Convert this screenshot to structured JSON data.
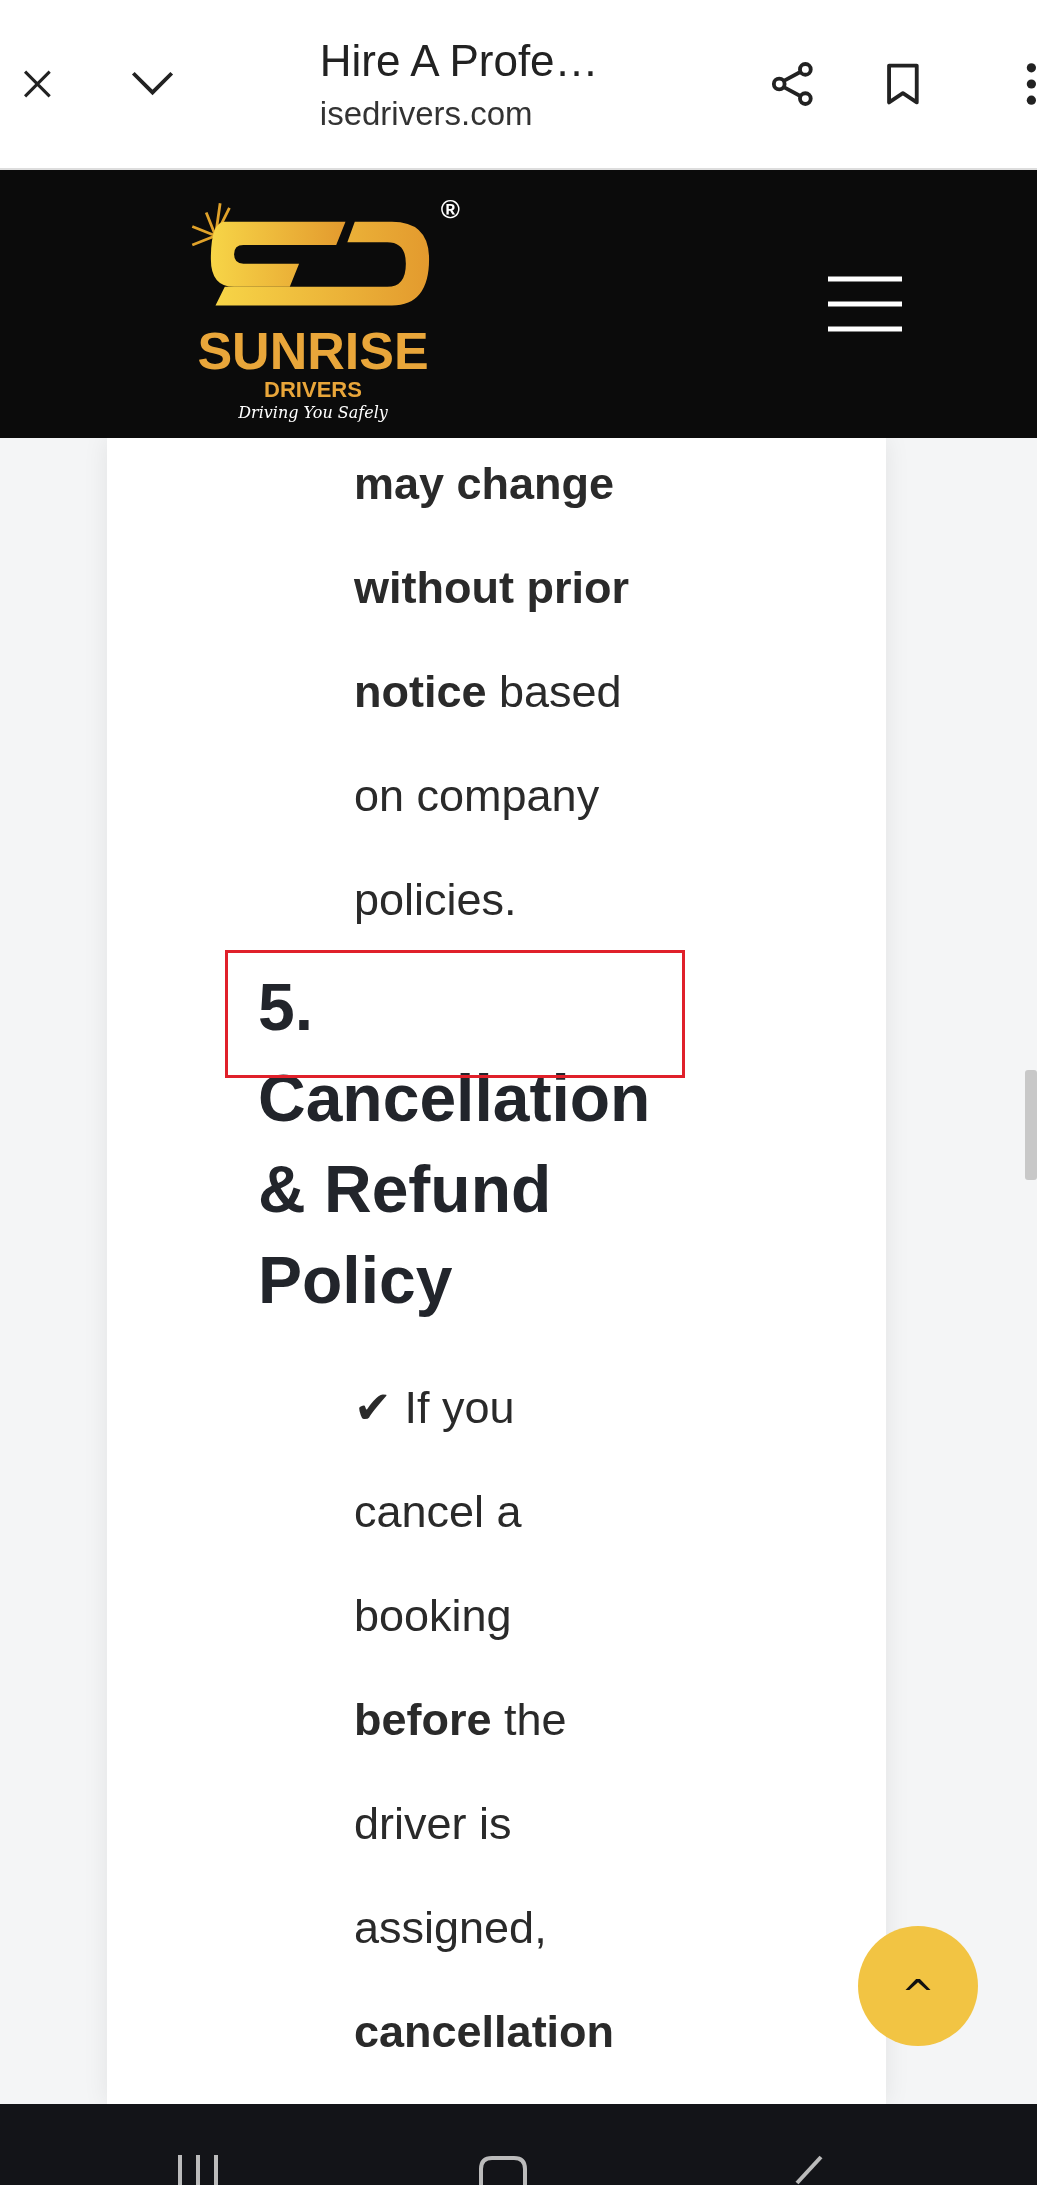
{
  "browser_bar": {
    "title": "Hire A Profe…",
    "url": "isedrivers.com"
  },
  "logo": {
    "name": "SUNRISE",
    "sub": "DRIVERS",
    "tagline": "Driving You Safely",
    "mark": "®"
  },
  "content": [
    {
      "kind": "paragraph",
      "text": "**may change without prior notice** based on company policies."
    },
    {
      "kind": "heading",
      "text": "5. Cancellation & Refund Policy",
      "highlighted": true
    },
    {
      "kind": "paragraph",
      "text": "✔ If you cancel a booking **before** the driver is assigned, **cancellation**"
    }
  ],
  "scroll_top_button": {
    "label": "^"
  }
}
